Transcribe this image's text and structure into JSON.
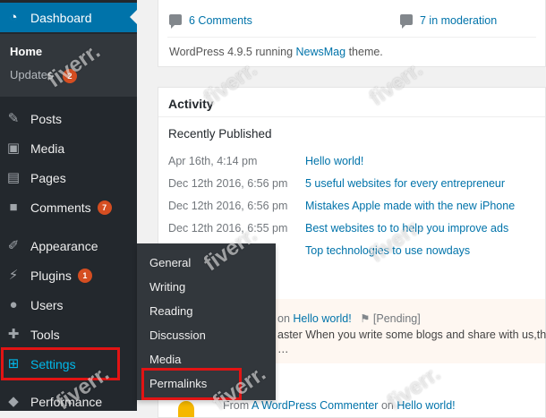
{
  "sidebar": {
    "dashboard": "Dashboard",
    "home": "Home",
    "updates": "Updates",
    "updates_count": "2",
    "posts": "Posts",
    "media": "Media",
    "pages": "Pages",
    "comments": "Comments",
    "comments_count": "7",
    "appearance": "Appearance",
    "plugins": "Plugins",
    "plugins_count": "1",
    "users": "Users",
    "tools": "Tools",
    "settings": "Settings",
    "performance": "Performance"
  },
  "settings_flyout": [
    "General",
    "Writing",
    "Reading",
    "Discussion",
    "Media",
    "Permalinks"
  ],
  "glance": {
    "comments_link": "6 Comments",
    "moderation_link": "7 in moderation",
    "version_text_before": "WordPress 4.9.5 running ",
    "theme_link": "NewsMag",
    "version_text_after": " theme."
  },
  "activity": {
    "title": "Activity",
    "recently_published": "Recently Published",
    "posts": [
      {
        "date": "Apr 16th, 4:14 pm",
        "title": "Hello world!"
      },
      {
        "date": "Dec 12th 2016, 6:56 pm",
        "title": "5 useful websites for every entrepreneur"
      },
      {
        "date": "Dec 12th 2016, 6:56 pm",
        "title": "Mistakes Apple made with the new iPhone"
      },
      {
        "date": "Dec 12th 2016, 6:55 pm",
        "title": "Best websites to to help you improve ads"
      },
      {
        "date": "",
        "title": "Top technologies to use nowdays"
      }
    ],
    "comment1_on": "on",
    "comment1_post": "Hello world!",
    "comment1_status": "[Pending]",
    "comment1_excerpt": "aster When you write some blogs and share with us,tha",
    "comment1_ellipsis": "…",
    "comment2_from": "From",
    "comment2_author": "A WordPress Commenter",
    "comment2_on": "on",
    "comment2_post": "Hello world!"
  },
  "watermark": "fiverr."
}
